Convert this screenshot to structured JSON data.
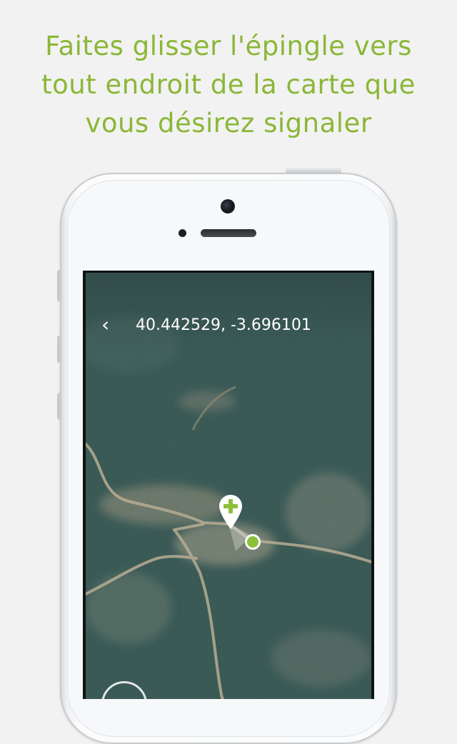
{
  "headline": {
    "line1": "Faites glisser l'épingle vers",
    "line2": "tout endroit de la carte que",
    "line3": "vous désirez signaler"
  },
  "colors": {
    "accent": "#8bb737",
    "pin_green": "#8bbf3a",
    "background": "#f2f2f2"
  },
  "map_screen": {
    "back_icon": "chevron-left-icon",
    "back_glyph": "‹",
    "coordinates": "40.442529, -3.696101",
    "pin_icon": "plus-pin-icon",
    "location_icon": "location-dot-icon"
  }
}
